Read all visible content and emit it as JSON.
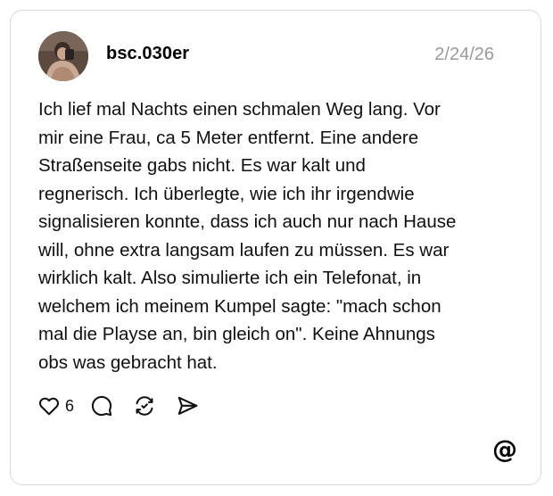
{
  "post": {
    "username": "bsc.030er",
    "timestamp": "2/24/26",
    "text": "Ich lief mal Nachts einen schmalen Weg lang. Vor\nmir eine Frau, ca 5 Meter entfernt. Eine andere\nStraßenseite gabs nicht. Es war kalt und\nregnerisch. Ich überlegte, wie ich ihr irgendwie\nsignalisieren konnte, dass ich auch nur nach Hause\nwill, ohne extra langsam laufen zu müssen. Es war\nwirklich kalt. Also simulierte ich ein Telefonat, in\nwelchem ich meinem Kumpel sagte: \"mach schon\nmal die Playse an, bin gleich on\". Keine Ahnungs\nobs was gebracht hat.",
    "like_count": "6"
  },
  "icons": {
    "like": "heart-icon",
    "comment": "comment-bubble-icon",
    "repost": "repost-icon",
    "share": "send-icon",
    "brand": "threads-logo-icon"
  },
  "colors": {
    "text": "#101010",
    "muted": "#9a9a9a",
    "border": "#d9d9d9",
    "background": "#ffffff"
  }
}
